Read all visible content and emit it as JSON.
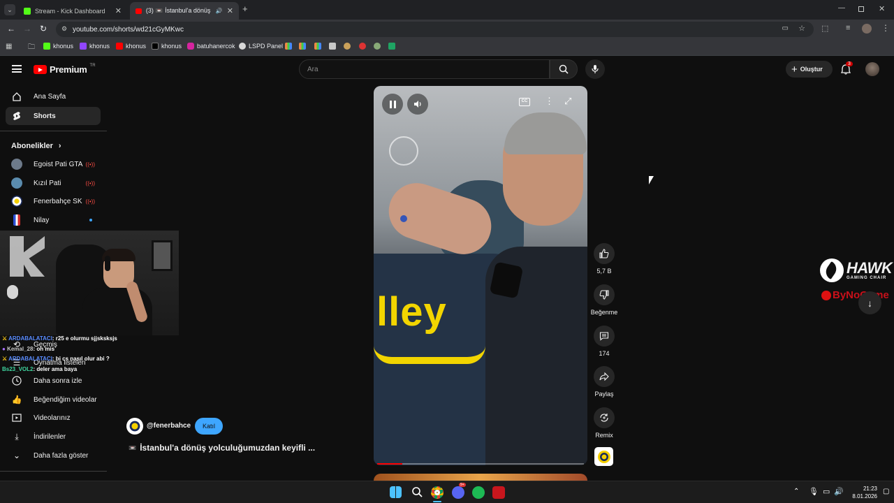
{
  "browser": {
    "tabs": [
      {
        "label": "Stream - Kick Dashboard",
        "active": false
      },
      {
        "label": "(3) 📼 İstanbul'a dönüş yolcu",
        "active": true
      }
    ],
    "url": "youtube.com/shorts/wd21cGyMKwc",
    "bookmarks": [
      "khonus",
      "khonus",
      "khonus",
      "khonus",
      "batuhanercok",
      "LSPD Panel"
    ]
  },
  "youtube": {
    "logo": "Premium",
    "logo_sup": "TR",
    "search_placeholder": "Ara",
    "create_label": "Oluştur",
    "notif_count": "3",
    "sidebar": {
      "home": "Ana Sayfa",
      "shorts": "Shorts",
      "subs_heading": "Abonelikler",
      "subs": [
        {
          "name": "Egoist Pati GTA",
          "live": true
        },
        {
          "name": "Kızıl Pati",
          "live": true
        },
        {
          "name": "Fenerbahçe SK",
          "live": true
        },
        {
          "name": "Nilay",
          "live": false
        }
      ],
      "history": "Geçmiş",
      "playlists": "Oynatma listeleri",
      "watch_later": "Daha sonra izle",
      "liked": "Beğendiğim videolar",
      "your_videos": "Videolarınız",
      "downloads": "İndirilenler",
      "more": "Daha fazla göster"
    },
    "short": {
      "channel": "@fenerbahce",
      "join": "Katıl",
      "title": "İstanbul'a dönüş yolculuğumuzdan keyifli ...",
      "likes": "5,7 B",
      "dislike": "Beğenme",
      "comments": "174",
      "share": "Paylaş",
      "remix": "Remix",
      "shirt_text": "lley"
    }
  },
  "stream_overlay": {
    "chat": [
      {
        "user": "ARDABALATACI",
        "msg": ": r25 e olurmu sjjsksksjs",
        "color": "#5a8cff"
      },
      {
        "user": "Kemal_28",
        "msg": ": oh mis",
        "color": "#c6c6c6"
      },
      {
        "user": "ARDABALATACI",
        "msg": ": bi cs nasıl olur abi ?",
        "color": "#5a8cff"
      },
      {
        "user": "Bs23_VOL2",
        "msg": ": deler ama baya",
        "color": "#3fd6a0"
      }
    ],
    "sponsor_1": "HAWK",
    "sponsor_1_sub": "GAMING CHAIR",
    "sponsor_2": "ByNoGame"
  },
  "taskbar": {
    "time": "21:23",
    "date": "8.01.2026",
    "discord_badge": "9+"
  }
}
